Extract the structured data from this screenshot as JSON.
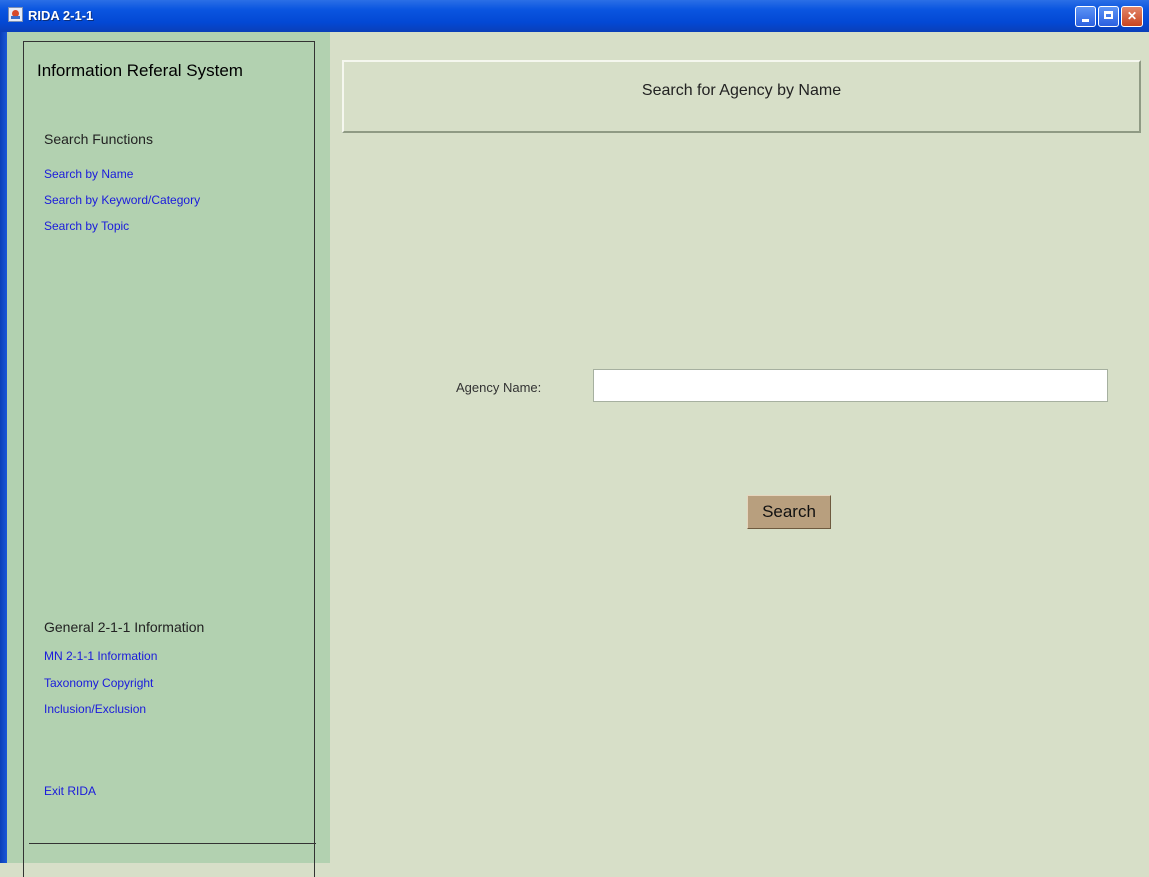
{
  "window": {
    "title": "RIDA 2-1-1",
    "controls": [
      "minimize-icon",
      "maximize-icon",
      "close-icon"
    ]
  },
  "sidebar": {
    "group_title": "Information Referal System",
    "search_heading": "Search Functions",
    "search_links": [
      "Search by Name",
      "Search by Keyword/Category",
      "Search by Topic"
    ],
    "info_heading": "General 2-1-1 Information",
    "info_links": [
      "MN 2-1-1 Information",
      "Taxonomy Copyright",
      "Inclusion/Exclusion"
    ],
    "exit_label": "Exit RIDA"
  },
  "main": {
    "header_title": "Search for Agency by Name",
    "agency_label": "Agency Name:",
    "agency_value": "",
    "search_button": "Search"
  },
  "colors": {
    "sidebar_bg": "#b2d1b0",
    "main_bg": "#d7dfc8",
    "link": "#1a1adc",
    "button": "#b89f7e",
    "titlebar": "#0348d4"
  }
}
